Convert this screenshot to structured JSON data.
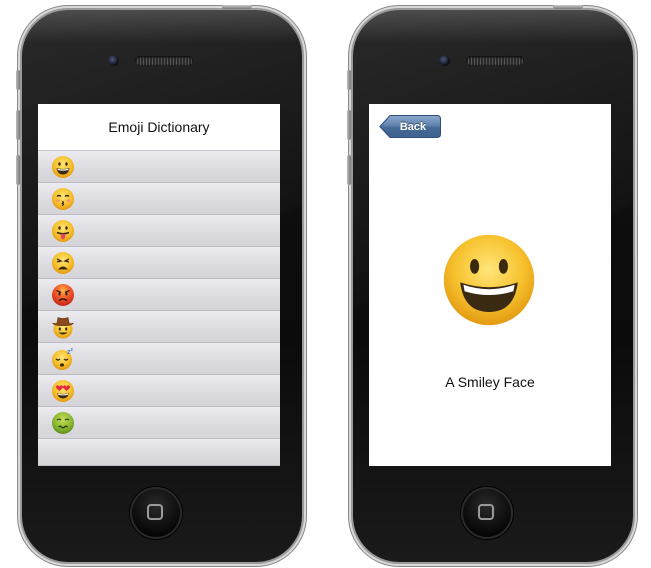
{
  "left_screen": {
    "title": "Emoji Dictionary",
    "rows": [
      {
        "icon": "grinning-face-icon"
      },
      {
        "icon": "kissing-face-icon"
      },
      {
        "icon": "tongue-out-face-icon"
      },
      {
        "icon": "weary-face-icon"
      },
      {
        "icon": "angry-face-icon"
      },
      {
        "icon": "cowboy-face-icon"
      },
      {
        "icon": "sleeping-face-icon"
      },
      {
        "icon": "heart-eyes-face-icon"
      },
      {
        "icon": "nauseated-face-icon"
      }
    ]
  },
  "right_screen": {
    "back_label": "Back",
    "emoji_icon": "grinning-face-icon",
    "caption": "A Smiley Face"
  },
  "colors": {
    "phone_body": "#0b0b0b",
    "row_background": "#dadadf",
    "back_button": "#5a7ea8",
    "emoji_yellow": "#f7c22e"
  }
}
